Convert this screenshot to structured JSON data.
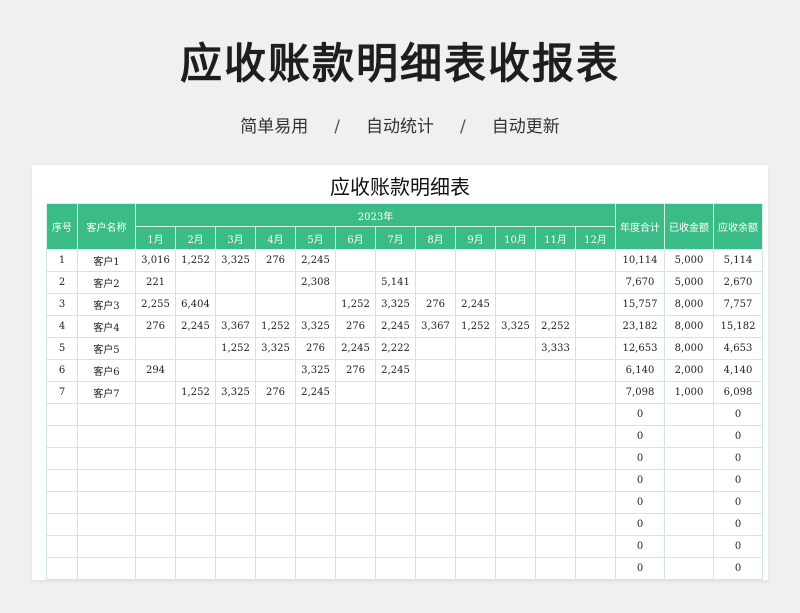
{
  "page_title": "应收账款明细表收报表",
  "subtitle": {
    "items": [
      "简单易用",
      "自动统计",
      "自动更新"
    ],
    "separator": "/"
  },
  "sheet": {
    "title": "应收账款明细表",
    "headers": {
      "seq": "序号",
      "customer": "客户名称",
      "year": "2023年",
      "months": [
        "1月",
        "2月",
        "3月",
        "4月",
        "5月",
        "6月",
        "7月",
        "8月",
        "9月",
        "10月",
        "11月",
        "12月"
      ],
      "year_total": "年度合计",
      "received": "已收金额",
      "receivable": "应收余额"
    },
    "rows": [
      {
        "seq": "1",
        "customer": "客户1",
        "months": [
          "3,016",
          "1,252",
          "3,325",
          "276",
          "2,245",
          "",
          "",
          "",
          "",
          "",
          "",
          ""
        ],
        "total": "10,114",
        "received": "5,000",
        "receivable": "5,114"
      },
      {
        "seq": "2",
        "customer": "客户2",
        "months": [
          "221",
          "",
          "",
          "",
          "2,308",
          "",
          "5,141",
          "",
          "",
          "",
          "",
          ""
        ],
        "total": "7,670",
        "received": "5,000",
        "receivable": "2,670"
      },
      {
        "seq": "3",
        "customer": "客户3",
        "months": [
          "2,255",
          "6,404",
          "",
          "",
          "",
          "1,252",
          "3,325",
          "276",
          "2,245",
          "",
          "",
          ""
        ],
        "total": "15,757",
        "received": "8,000",
        "receivable": "7,757"
      },
      {
        "seq": "4",
        "customer": "客户4",
        "months": [
          "276",
          "2,245",
          "3,367",
          "1,252",
          "3,325",
          "276",
          "2,245",
          "3,367",
          "1,252",
          "3,325",
          "2,252",
          ""
        ],
        "total": "23,182",
        "received": "8,000",
        "receivable": "15,182"
      },
      {
        "seq": "5",
        "customer": "客户5",
        "months": [
          "",
          "",
          "1,252",
          "3,325",
          "276",
          "2,245",
          "2,222",
          "",
          "",
          "",
          "3,333",
          ""
        ],
        "total": "12,653",
        "received": "8,000",
        "receivable": "4,653"
      },
      {
        "seq": "6",
        "customer": "客户6",
        "months": [
          "294",
          "",
          "",
          "",
          "3,325",
          "276",
          "2,245",
          "",
          "",
          "",
          "",
          ""
        ],
        "total": "6,140",
        "received": "2,000",
        "receivable": "4,140"
      },
      {
        "seq": "7",
        "customer": "客户7",
        "months": [
          "",
          "1,252",
          "3,325",
          "276",
          "2,245",
          "",
          "",
          "",
          "",
          "",
          "",
          ""
        ],
        "total": "7,098",
        "received": "1,000",
        "receivable": "6,098"
      },
      {
        "seq": "",
        "customer": "",
        "months": [
          "",
          "",
          "",
          "",
          "",
          "",
          "",
          "",
          "",
          "",
          "",
          ""
        ],
        "total": "0",
        "received": "",
        "receivable": "0"
      },
      {
        "seq": "",
        "customer": "",
        "months": [
          "",
          "",
          "",
          "",
          "",
          "",
          "",
          "",
          "",
          "",
          "",
          ""
        ],
        "total": "0",
        "received": "",
        "receivable": "0"
      },
      {
        "seq": "",
        "customer": "",
        "months": [
          "",
          "",
          "",
          "",
          "",
          "",
          "",
          "",
          "",
          "",
          "",
          ""
        ],
        "total": "0",
        "received": "",
        "receivable": "0"
      },
      {
        "seq": "",
        "customer": "",
        "months": [
          "",
          "",
          "",
          "",
          "",
          "",
          "",
          "",
          "",
          "",
          "",
          ""
        ],
        "total": "0",
        "received": "",
        "receivable": "0"
      },
      {
        "seq": "",
        "customer": "",
        "months": [
          "",
          "",
          "",
          "",
          "",
          "",
          "",
          "",
          "",
          "",
          "",
          ""
        ],
        "total": "0",
        "received": "",
        "receivable": "0"
      },
      {
        "seq": "",
        "customer": "",
        "months": [
          "",
          "",
          "",
          "",
          "",
          "",
          "",
          "",
          "",
          "",
          "",
          ""
        ],
        "total": "0",
        "received": "",
        "receivable": "0"
      },
      {
        "seq": "",
        "customer": "",
        "months": [
          "",
          "",
          "",
          "",
          "",
          "",
          "",
          "",
          "",
          "",
          "",
          ""
        ],
        "total": "0",
        "received": "",
        "receivable": "0"
      },
      {
        "seq": "",
        "customer": "",
        "months": [
          "",
          "",
          "",
          "",
          "",
          "",
          "",
          "",
          "",
          "",
          "",
          ""
        ],
        "total": "0",
        "received": "",
        "receivable": "0"
      }
    ]
  },
  "colors": {
    "header_bg": "#3bbb88",
    "grid_line": "#cfe7d9",
    "page_bg": "#eef0f2"
  }
}
